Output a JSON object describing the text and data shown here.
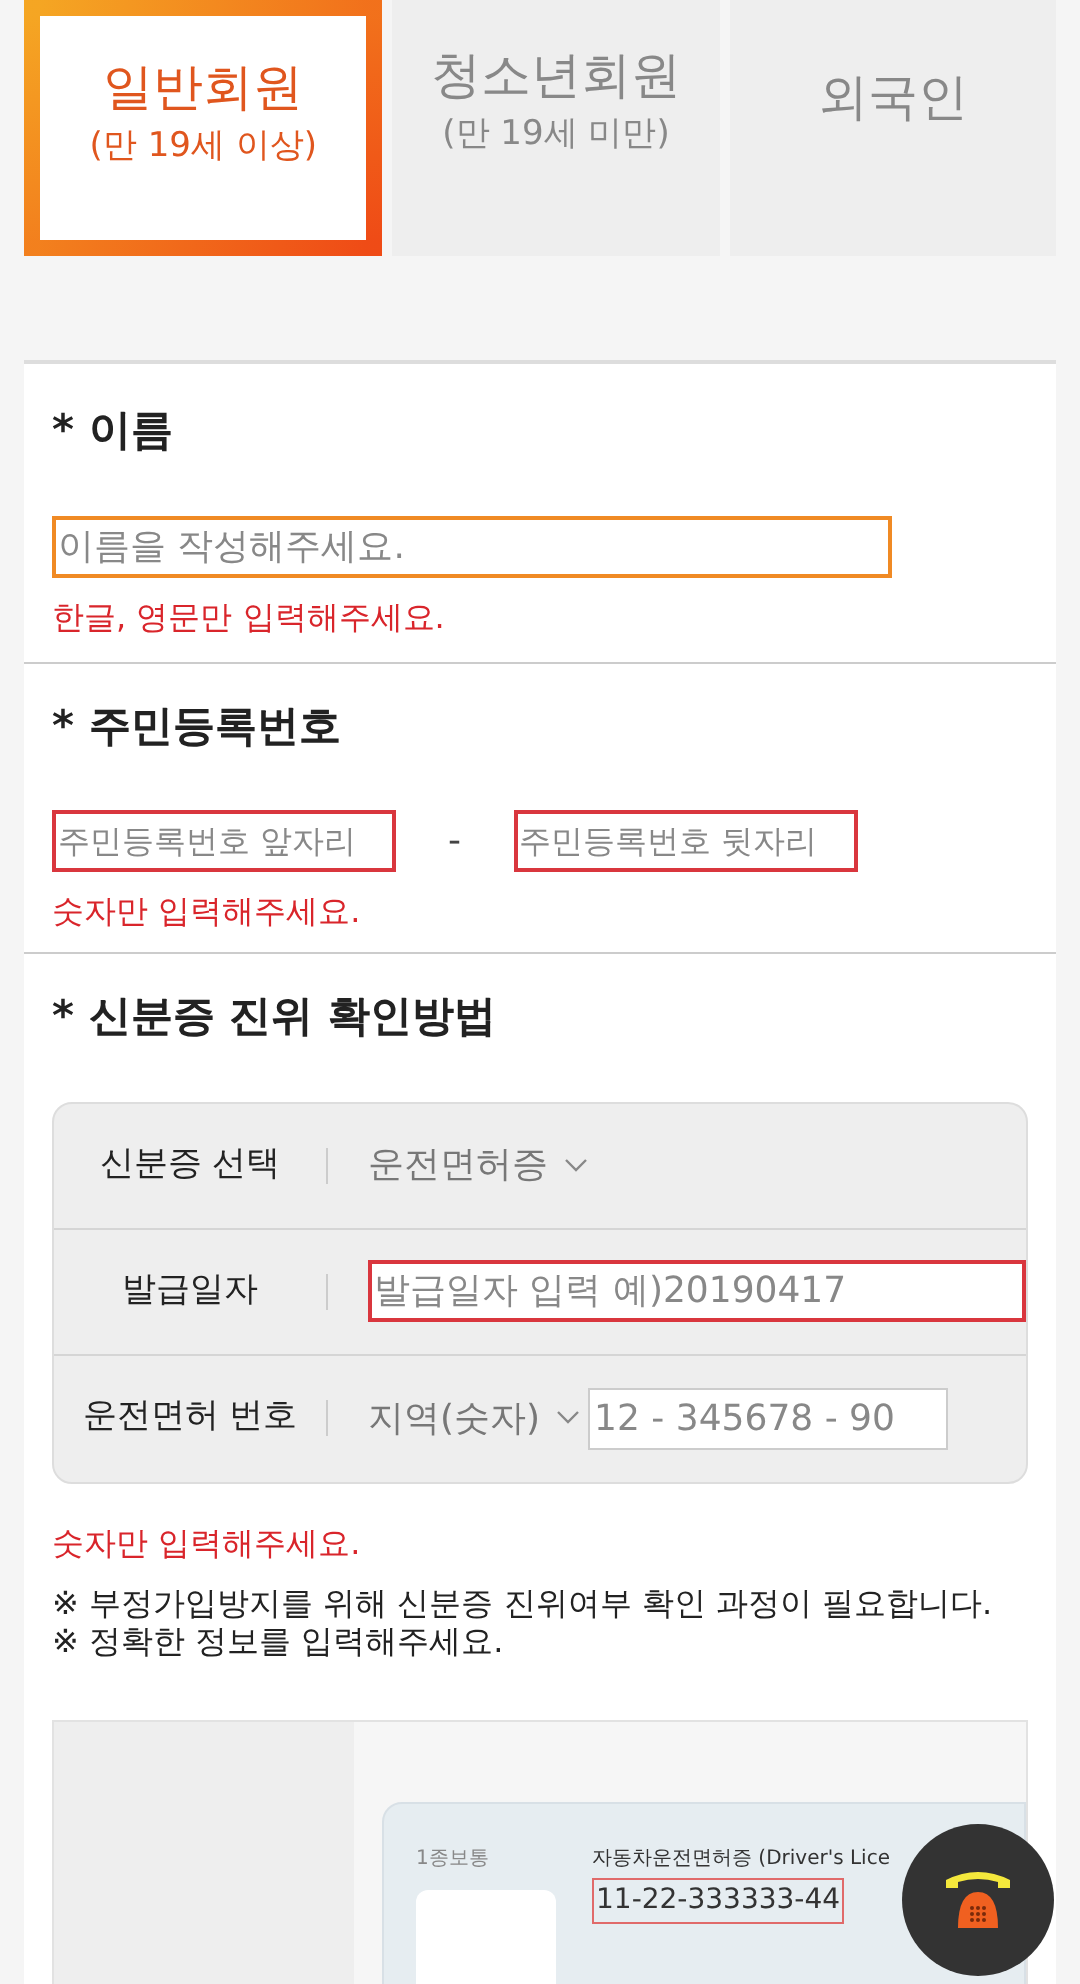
{
  "member_tabs": [
    {
      "label": "일반회원",
      "sublabel": "(만 19세 이상)",
      "selected": true
    },
    {
      "label": "청소년회원",
      "sublabel": "(만 19세 미만)",
      "selected": false
    },
    {
      "label": "외국인",
      "selected": false
    }
  ],
  "name_section": {
    "title": "* 이름",
    "placeholder": "이름을 작성해주세요.",
    "focused": true,
    "error": "한글, 영문만 입력해주세요."
  },
  "resident_section": {
    "title": "* 주민등록번호",
    "front_placeholder": "주민등록번호 앞자리",
    "separator": "-",
    "back_placeholder": "주민등록번호 뒷자리",
    "error": "숫자만 입력해주세요."
  },
  "id_section": {
    "title": "* 신분증 진위 확인방법",
    "rows": [
      {
        "kind": "select",
        "label": "신분증 선택",
        "value": "운전면허증"
      },
      {
        "kind": "input",
        "label": "발급일자",
        "placeholder": "발급일자 입력 예)20190417"
      },
      {
        "kind": "select_input",
        "label": "운전면허 번호",
        "value": "지역(숫자)",
        "placeholder": "12 - 345678 - 90"
      }
    ],
    "error": "숫자만 입력해주세요.",
    "notes": [
      "※ 부정가입방지를 위해 신분증 진위여부 확인 과정이 필요합니다.",
      "※ 정확한 정보를 입력해주세요."
    ]
  },
  "sample_card": {
    "license_type": "1종보통",
    "title": "자동차운전면허증 (Driver's Lice",
    "number": "11-22-333333-44"
  }
}
